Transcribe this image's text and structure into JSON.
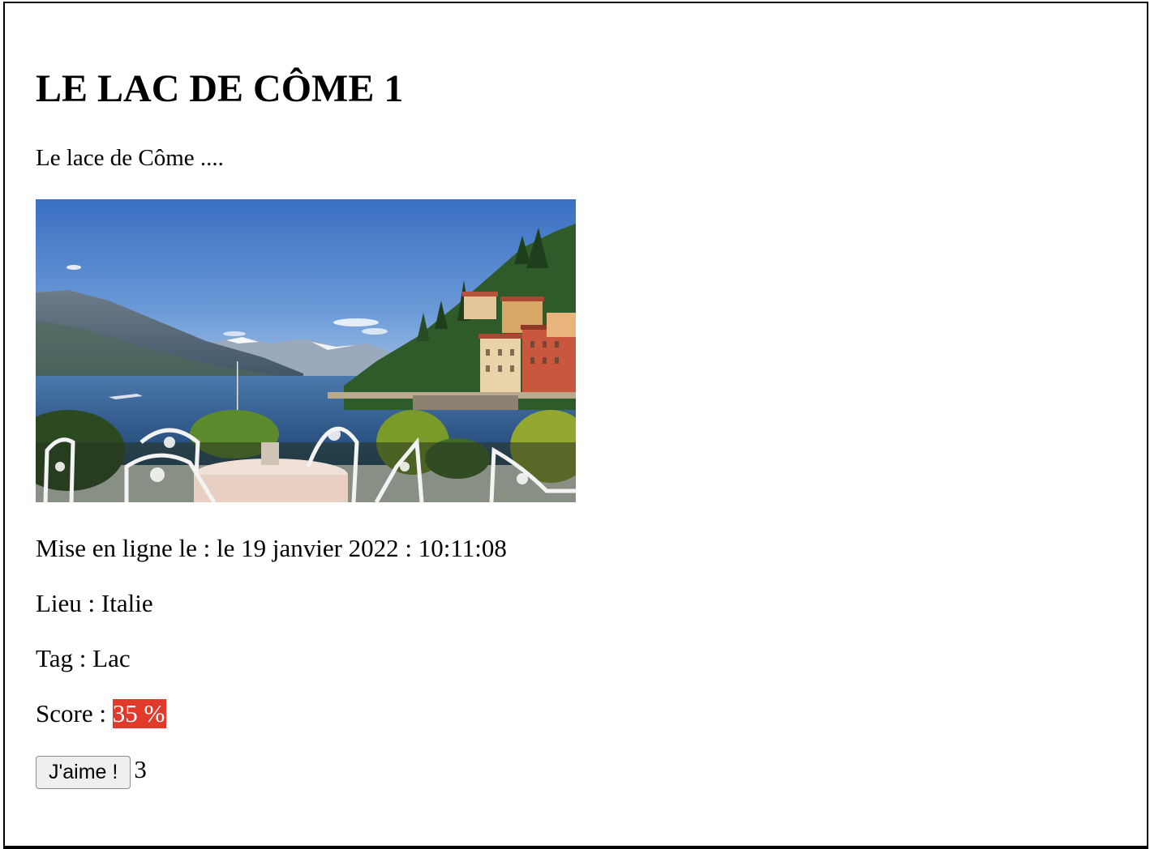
{
  "article": {
    "title": "LE LAC DE CÔME 1",
    "description": "Le lace de Côme ....",
    "photo_alt": "Lac de Côme",
    "published_label": "Mise en ligne le : ",
    "published_value": "le 19 janvier 2022 : 10:11:08",
    "location_label": "Lieu : ",
    "location_value": "Italie",
    "tag_label": "Tag : ",
    "tag_value": "Lac",
    "score_label": "Score : ",
    "score_value": "35 %",
    "like_button_label": "J'aime !",
    "like_count": "3"
  },
  "colors": {
    "score_badge": "#e23a2a",
    "score_text": "#ffffff",
    "sky_top": "#3a6fc2",
    "lake": "#2e5d93"
  }
}
